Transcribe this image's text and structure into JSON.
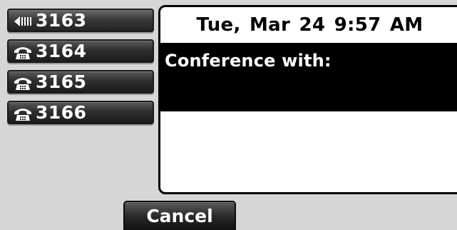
{
  "line_keys": [
    {
      "label": "3163",
      "icon": "speaker-icon",
      "state": "active"
    },
    {
      "label": "3164",
      "icon": "phone-icon",
      "state": "idle"
    },
    {
      "label": "3165",
      "icon": "phone-icon",
      "state": "idle"
    },
    {
      "label": "3166",
      "icon": "phone-icon",
      "state": "idle"
    }
  ],
  "status": {
    "datetime": "Tue, Mar 24  9:57 AM"
  },
  "call": {
    "conference_label": "Conference with:"
  },
  "softkeys": {
    "cancel_label": "Cancel"
  },
  "colors": {
    "screen_background": "#d6d6d6",
    "key_face": "#2e2e2e",
    "panel_background": "#ffffff",
    "highlight_band": "#000000",
    "text_light": "#ffffff",
    "text_dark": "#000000"
  }
}
